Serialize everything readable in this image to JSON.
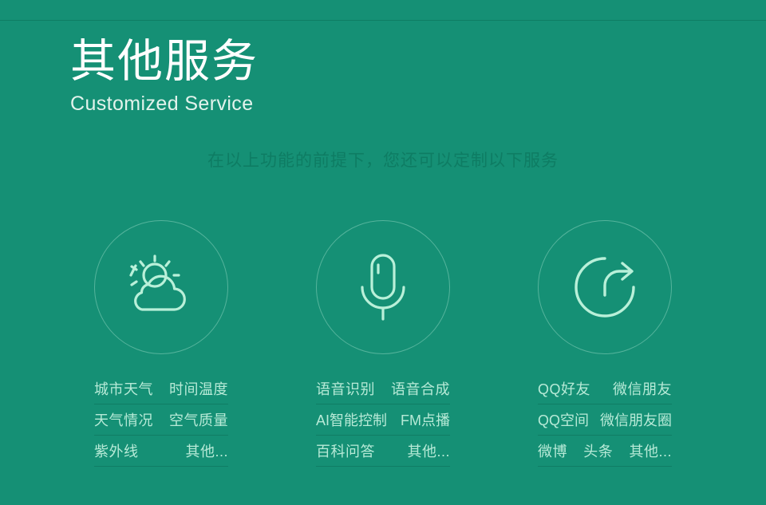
{
  "theme": {
    "background": "#159075",
    "title_color": "#ffffff",
    "subtitle_color": "#e2f3ec",
    "caption_color": "#0e7c63",
    "item_text_color": "#b7ead7",
    "icon_color": "#b9f0d9",
    "divider_color": "#107c63"
  },
  "heading": {
    "title_cn": "其他服务",
    "title_en": "Customized Service"
  },
  "caption": "在以上功能的前提下，您还可以定制以下服务",
  "columns": [
    {
      "icon": "sun-behind-cloud-icon",
      "icon_label": "天气",
      "rows": [
        [
          "城市天气",
          "时间温度"
        ],
        [
          "天气情况",
          "空气质量"
        ],
        [
          "紫外线",
          "其他..."
        ]
      ]
    },
    {
      "icon": "microphone-icon",
      "icon_label": "语音",
      "rows": [
        [
          "语音识别",
          "语音合成"
        ],
        [
          "AI智能控制",
          "FM点播"
        ],
        [
          "百科问答",
          "其他..."
        ]
      ]
    },
    {
      "icon": "share-arrow-icon",
      "icon_label": "分享",
      "rows": [
        [
          "QQ好友",
          "微信朋友"
        ],
        [
          "QQ空间",
          "微信朋友圈"
        ],
        [
          "微博",
          "头条",
          "其他..."
        ]
      ]
    }
  ]
}
